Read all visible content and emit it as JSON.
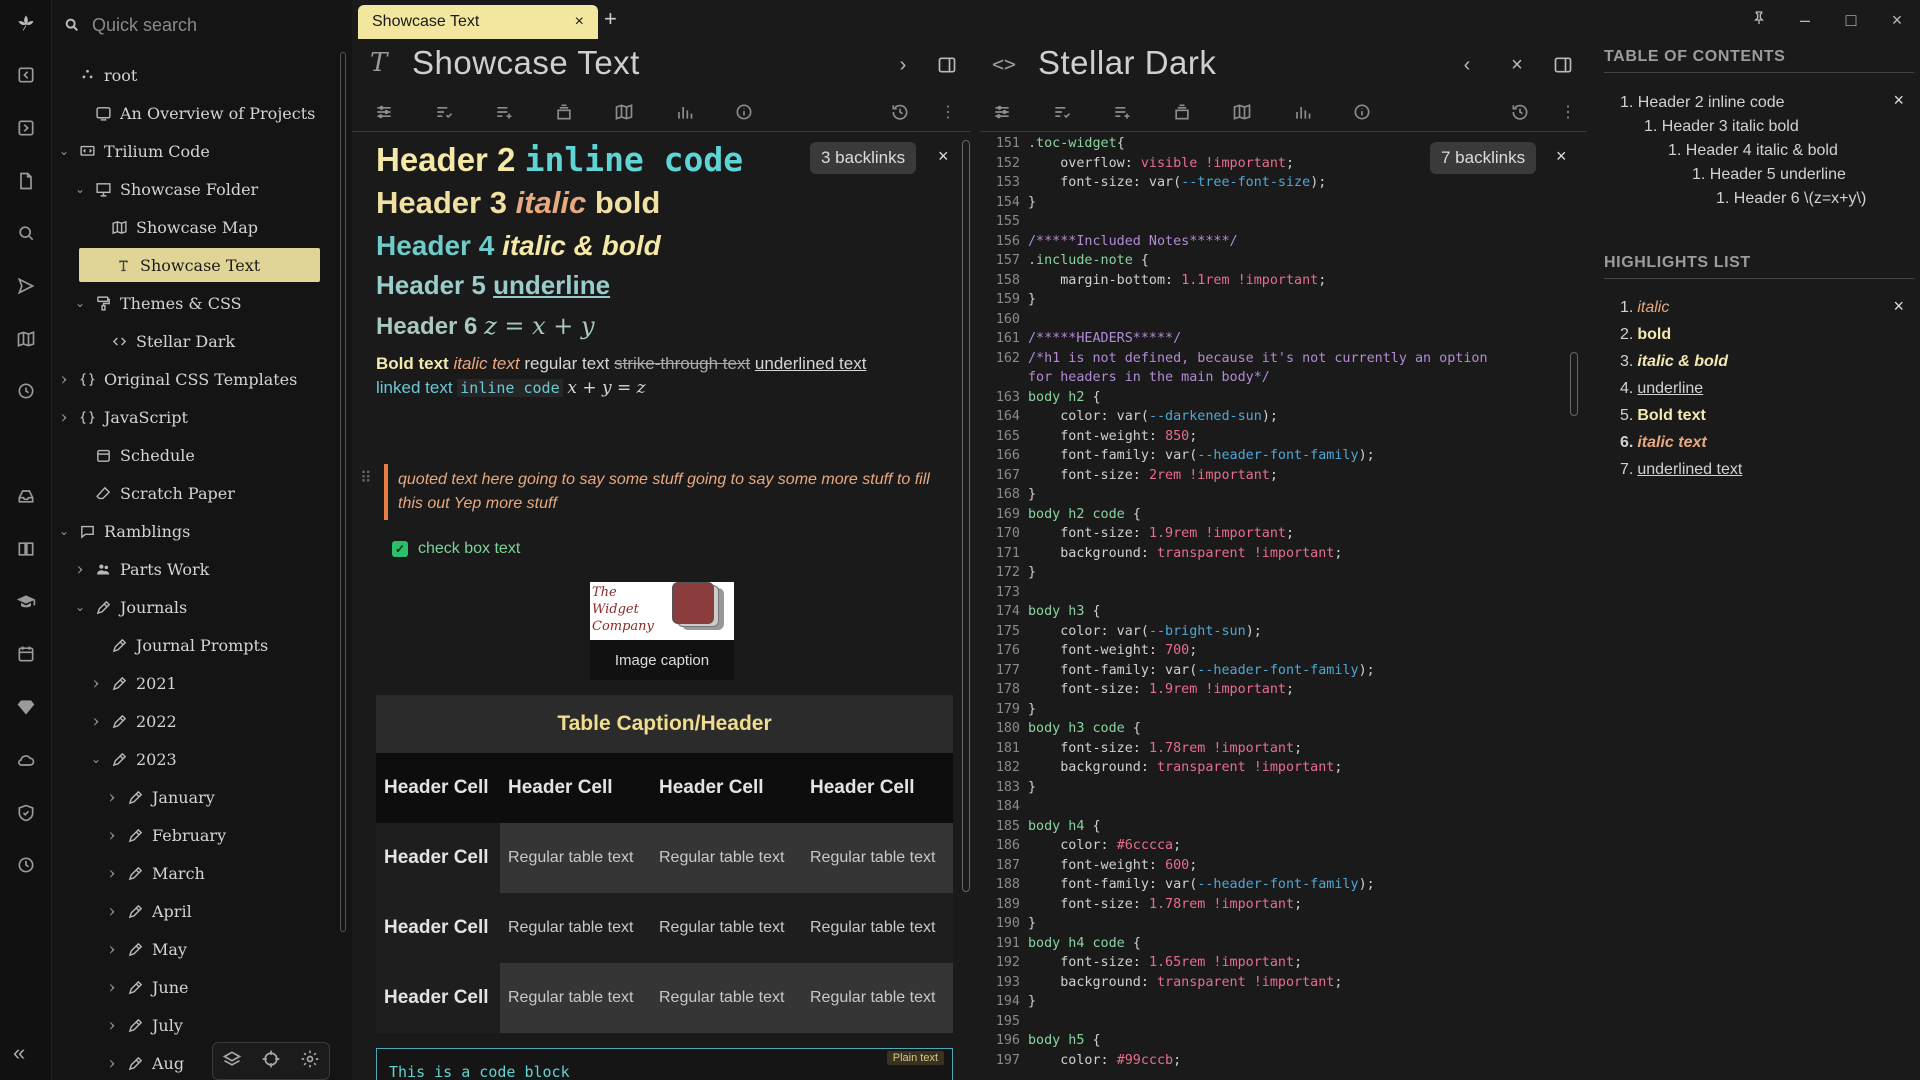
{
  "search": {
    "placeholder": "Quick search"
  },
  "tree": {
    "items": [
      {
        "label": "root",
        "icon": "root-icon"
      },
      {
        "label": "An Overview of Projects",
        "icon": "dashboard-icon"
      },
      {
        "label": "Trilium Code",
        "icon": "monitor-icon"
      },
      {
        "label": "Showcase Folder",
        "icon": "presentation-icon"
      },
      {
        "label": "Showcase Map",
        "icon": "map-icon"
      },
      {
        "label": "Showcase Text",
        "icon": "text-note-icon"
      },
      {
        "label": "Themes & CSS",
        "icon": "paint-roller-icon"
      },
      {
        "label": "Stellar Dark",
        "icon": "code-icon"
      },
      {
        "label": "Original CSS Templates",
        "icon": "braces-icon"
      },
      {
        "label": "JavaScript",
        "icon": "braces-icon"
      },
      {
        "label": "Schedule",
        "icon": "calendar-icon"
      },
      {
        "label": "Scratch Paper",
        "icon": "eraser-icon"
      },
      {
        "label": "Ramblings",
        "icon": "chat-icon"
      },
      {
        "label": "Parts Work",
        "icon": "people-icon"
      },
      {
        "label": "Journals",
        "icon": "pen-icon"
      },
      {
        "label": "Journal Prompts",
        "icon": "pen-icon"
      },
      {
        "label": "2021",
        "icon": "pen-icon"
      },
      {
        "label": "2022",
        "icon": "pen-icon"
      },
      {
        "label": "2023",
        "icon": "pen-icon"
      },
      {
        "label": "January",
        "icon": "pen-icon"
      },
      {
        "label": "February",
        "icon": "pen-icon"
      },
      {
        "label": "March",
        "icon": "pen-icon"
      },
      {
        "label": "April",
        "icon": "pen-icon"
      },
      {
        "label": "May",
        "icon": "pen-icon"
      },
      {
        "label": "June",
        "icon": "pen-icon"
      },
      {
        "label": "July",
        "icon": "pen-icon"
      },
      {
        "label": "Aug",
        "icon": "pen-icon"
      }
    ]
  },
  "tabs": [
    {
      "label": "Showcase Text",
      "close": "×"
    }
  ],
  "tab_add": "+",
  "window_controls": {
    "pin": "pin-icon",
    "minimize": "–",
    "maximize": "□",
    "close": "×"
  },
  "left_pane": {
    "title": "Showcase Text",
    "type_icon": "T",
    "backlinks": "3 backlinks",
    "h2_text": "Header 2 ",
    "h2_code": "inline code",
    "h3_text": "Header 3 ",
    "h3_italic": "italic",
    "h3_bold": " bold",
    "h4_text": "Header 4 ",
    "h4_bi": "italic & bold",
    "h5_text": "Header 5 ",
    "h5_u": "underline",
    "h6_text": "Header 6 ",
    "h6_math": "z = x + y",
    "para": {
      "bold": "Bold text",
      "italic": "italic text",
      "regular": "regular text",
      "strike": "strike-through text",
      "underline": "underlined text",
      "link": "linked text",
      "code": "inline code",
      "math": "x + y = z"
    },
    "quote": "quoted text here going to say some stuff going to say some more stuff to fill this out Yep more stuff",
    "checkbox": "check box text",
    "image": {
      "line1": "The",
      "line2": "Widget",
      "line3": "Company",
      "caption": "Image caption"
    },
    "table": {
      "caption": "Table Caption/Header",
      "header": [
        "Header Cell",
        "Header Cell",
        "Header Cell",
        "Header Cell"
      ],
      "rows": [
        [
          "Header Cell",
          "Regular table text",
          "Regular table text",
          "Regular table text"
        ],
        [
          "Header Cell",
          "Regular table text",
          "Regular table text",
          "Regular table text"
        ],
        [
          "Header Cell",
          "Regular table text",
          "Regular table text",
          "Regular table text"
        ]
      ]
    },
    "code_block": "This is a code block",
    "code_lang": "Plain text"
  },
  "right_pane": {
    "title": "Stellar Dark",
    "backlinks": "7 backlinks",
    "code_lines": [
      {
        "n": "151",
        "t": ".toc-widget{",
        "k": "sel"
      },
      {
        "n": "152",
        "t": "    overflow: visible !important;",
        "k": "prop"
      },
      {
        "n": "153",
        "t": "    font-size: var(--tree-font-size);",
        "k": "prop"
      },
      {
        "n": "154",
        "t": "}",
        "k": "plain"
      },
      {
        "n": "155",
        "t": "",
        "k": "plain"
      },
      {
        "n": "156",
        "t": "/*****Included Notes*****/",
        "k": "com"
      },
      {
        "n": "157",
        "t": ".include-note {",
        "k": "sel"
      },
      {
        "n": "158",
        "t": "    margin-bottom: 1.1rem !important;",
        "k": "prop"
      },
      {
        "n": "159",
        "t": "}",
        "k": "plain"
      },
      {
        "n": "160",
        "t": "",
        "k": "plain"
      },
      {
        "n": "161",
        "t": "/*****HEADERS*****/",
        "k": "com"
      },
      {
        "n": "162",
        "t": "/*h1 is not defined, because it's not currently an option",
        "k": "com"
      },
      {
        "n": "",
        "t": "for headers in the main body*/",
        "k": "com"
      },
      {
        "n": "163",
        "t": "body h2 {",
        "k": "sel"
      },
      {
        "n": "164",
        "t": "    color: var(--darkened-sun);",
        "k": "prop"
      },
      {
        "n": "165",
        "t": "    font-weight: 850;",
        "k": "prop"
      },
      {
        "n": "166",
        "t": "    font-family: var(--header-font-family);",
        "k": "prop"
      },
      {
        "n": "167",
        "t": "    font-size: 2rem !important;",
        "k": "prop"
      },
      {
        "n": "168",
        "t": "}",
        "k": "plain"
      },
      {
        "n": "169",
        "t": "body h2 code {",
        "k": "sel"
      },
      {
        "n": "170",
        "t": "    font-size: 1.9rem !important;",
        "k": "prop"
      },
      {
        "n": "171",
        "t": "    background: transparent !important;",
        "k": "prop"
      },
      {
        "n": "172",
        "t": "}",
        "k": "plain"
      },
      {
        "n": "173",
        "t": "",
        "k": "plain"
      },
      {
        "n": "174",
        "t": "body h3 {",
        "k": "sel"
      },
      {
        "n": "175",
        "t": "    color: var(--bright-sun);",
        "k": "prop"
      },
      {
        "n": "176",
        "t": "    font-weight: 700;",
        "k": "prop"
      },
      {
        "n": "177",
        "t": "    font-family: var(--header-font-family);",
        "k": "prop"
      },
      {
        "n": "178",
        "t": "    font-size: 1.9rem !important;",
        "k": "prop"
      },
      {
        "n": "179",
        "t": "}",
        "k": "plain"
      },
      {
        "n": "180",
        "t": "body h3 code {",
        "k": "sel"
      },
      {
        "n": "181",
        "t": "    font-size: 1.78rem !important;",
        "k": "prop"
      },
      {
        "n": "182",
        "t": "    background: transparent !important;",
        "k": "prop"
      },
      {
        "n": "183",
        "t": "}",
        "k": "plain"
      },
      {
        "n": "184",
        "t": "",
        "k": "plain"
      },
      {
        "n": "185",
        "t": "body h4 {",
        "k": "sel"
      },
      {
        "n": "186",
        "t": "    color: #6cccca;",
        "k": "prop"
      },
      {
        "n": "187",
        "t": "    font-weight: 600;",
        "k": "prop"
      },
      {
        "n": "188",
        "t": "    font-family: var(--header-font-family);",
        "k": "prop"
      },
      {
        "n": "189",
        "t": "    font-size: 1.78rem !important;",
        "k": "prop"
      },
      {
        "n": "190",
        "t": "}",
        "k": "plain"
      },
      {
        "n": "191",
        "t": "body h4 code {",
        "k": "sel"
      },
      {
        "n": "192",
        "t": "    font-size: 1.65rem !important;",
        "k": "prop"
      },
      {
        "n": "193",
        "t": "    background: transparent !important;",
        "k": "prop"
      },
      {
        "n": "194",
        "t": "}",
        "k": "plain"
      },
      {
        "n": "195",
        "t": "",
        "k": "plain"
      },
      {
        "n": "196",
        "t": "body h5 {",
        "k": "sel"
      },
      {
        "n": "197",
        "t": "    color: #99cccb;",
        "k": "prop"
      }
    ]
  },
  "toc": {
    "title": "TABLE OF CONTENTS",
    "items": [
      "1. Header 2 inline code",
      "1. Header 3 italic bold",
      "1. Header 4 italic & bold",
      "1. Header 5 underline",
      "1. Header 6 \\(z=x+y\\)"
    ]
  },
  "highlights": {
    "title": "HIGHLIGHTS LIST",
    "items": [
      {
        "n": "1.",
        "v": "italic",
        "style": "italic"
      },
      {
        "n": "2.",
        "v": "bold",
        "style": "bold"
      },
      {
        "n": "3.",
        "v": "italic & bold",
        "style": "bolditalic"
      },
      {
        "n": "4.",
        "v": "underline",
        "style": "underline"
      },
      {
        "n": "5.",
        "v": "Bold text",
        "style": "bold"
      },
      {
        "n": "6.",
        "v": "italic text",
        "style": "italic6"
      },
      {
        "n": "7.",
        "v": "underlined text",
        "style": "underline"
      }
    ]
  },
  "colors": {
    "accent": "#f3e79f",
    "active_tree": "#e0d597",
    "header2": "#f6e9a8",
    "header4": "#6cccca",
    "header5": "#99cccb",
    "quote": "#e8a97f"
  }
}
